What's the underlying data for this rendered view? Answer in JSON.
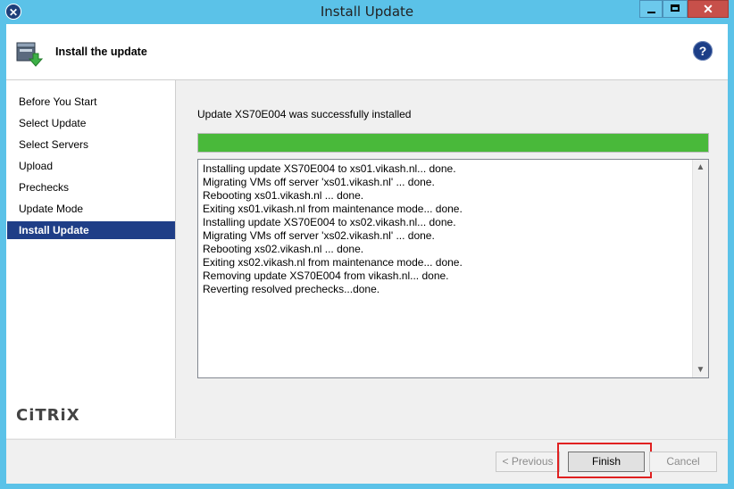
{
  "window": {
    "title": "Install Update",
    "accent_color": "#5bc2e8"
  },
  "header": {
    "title": "Install the update",
    "help_label": "?"
  },
  "sidebar": {
    "items": [
      {
        "label": "Before You Start"
      },
      {
        "label": "Select Update"
      },
      {
        "label": "Select Servers"
      },
      {
        "label": "Upload"
      },
      {
        "label": "Prechecks"
      },
      {
        "label": "Update Mode"
      },
      {
        "label": "Install Update",
        "active": true
      }
    ],
    "logo": "CiTRiX"
  },
  "main": {
    "status": "Update XS70E004 was successfully installed",
    "progress_fraction": 1.0,
    "progress_color": "#49b93a",
    "log": [
      "Installing update XS70E004 to xs01.vikash.nl... done.",
      "Migrating VMs off server 'xs01.vikash.nl' ... done.",
      "Rebooting xs01.vikash.nl ... done.",
      "Exiting xs01.vikash.nl from maintenance mode... done.",
      "Installing update XS70E004 to xs02.vikash.nl... done.",
      "Migrating VMs off server 'xs02.vikash.nl' ... done.",
      "Rebooting xs02.vikash.nl ... done.",
      "Exiting xs02.vikash.nl from maintenance mode... done.",
      "Removing update XS70E004 from vikash.nl... done.",
      "Reverting resolved prechecks...done."
    ]
  },
  "footer": {
    "previous_label": "< Previous",
    "finish_label": "Finish",
    "cancel_label": "Cancel"
  }
}
